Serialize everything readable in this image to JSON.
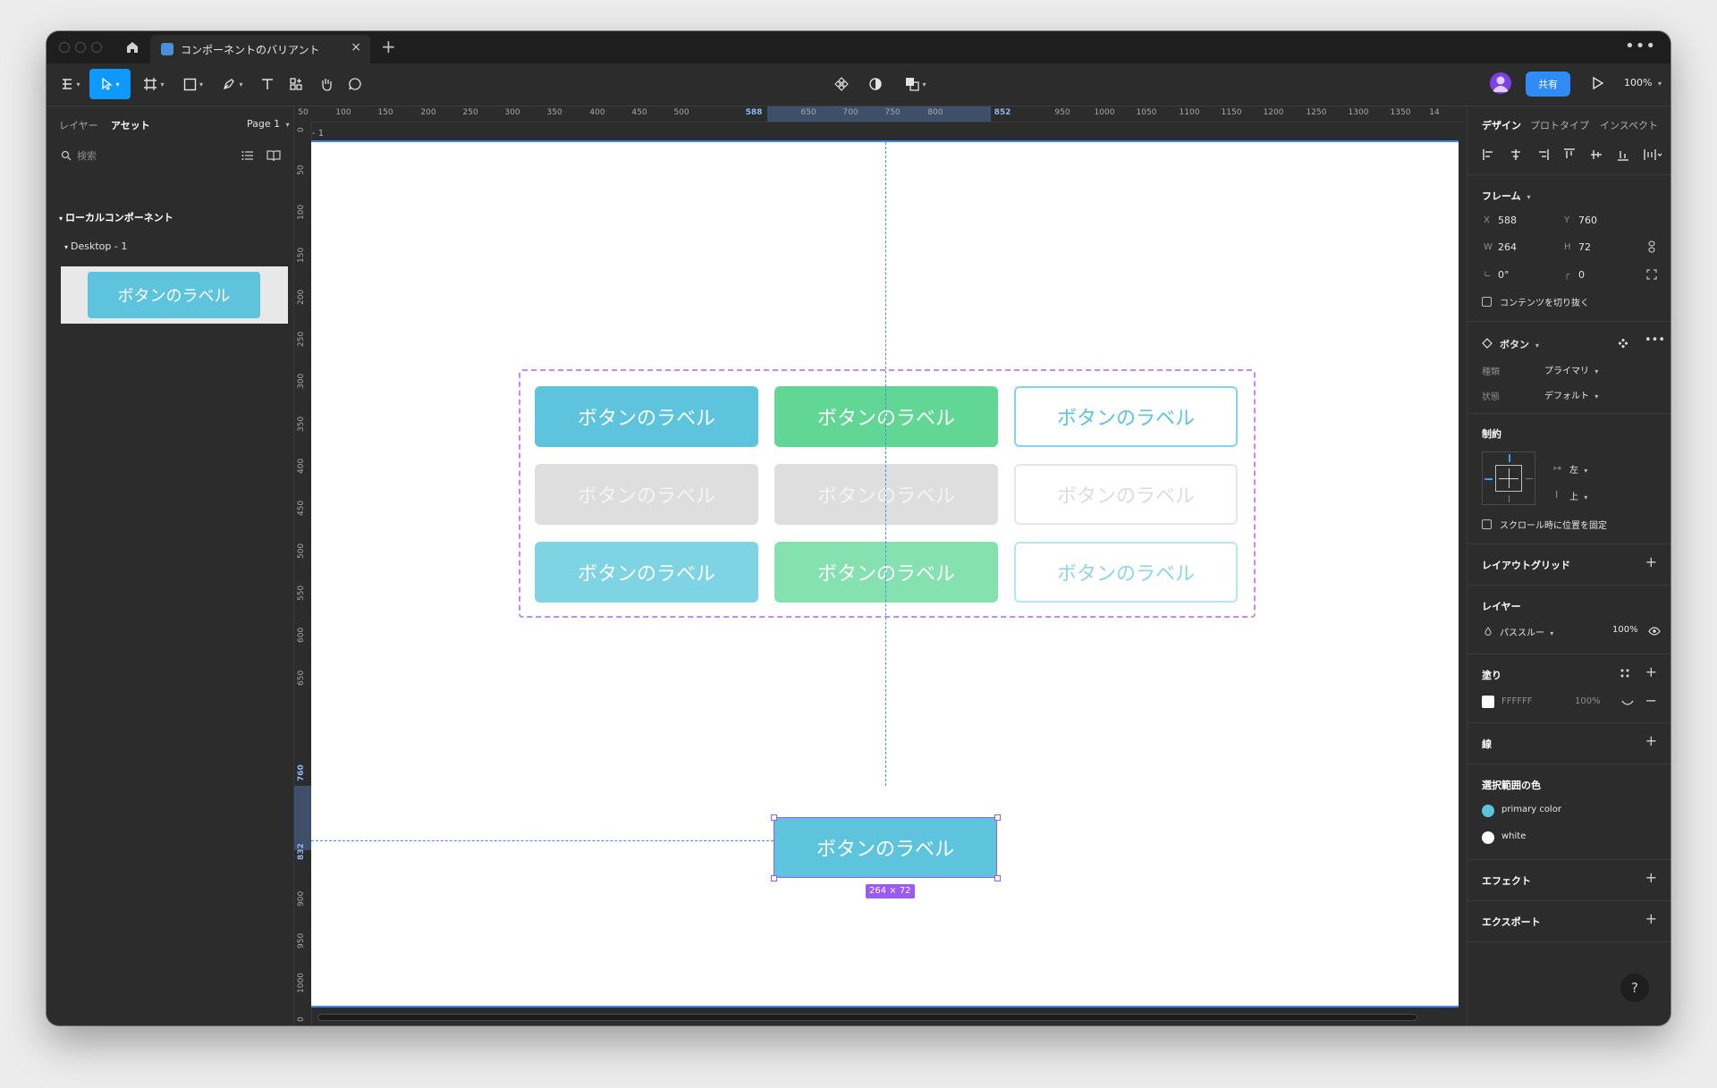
{
  "tab": {
    "title": "コンポーネントのバリアント"
  },
  "toolbar": {
    "share_label": "共有",
    "zoom": "100%"
  },
  "left_panel": {
    "tab_layers": "レイヤー",
    "tab_assets": "アセット",
    "page": "Page 1",
    "search_placeholder": "検索",
    "section_local": "ローカルコンポーネント",
    "frame_name": "Desktop - 1",
    "thumb_label": "ボタンのラベル"
  },
  "rulers": {
    "h_ticks": [
      "50",
      "100",
      "150",
      "200",
      "250",
      "300",
      "350",
      "400",
      "450",
      "500",
      "588",
      "650",
      "700",
      "750",
      "800",
      "852",
      "950",
      "1000",
      "1050",
      "1100",
      "1150",
      "1200",
      "1250",
      "1300",
      "1350",
      "14"
    ],
    "v_ticks": [
      "0",
      "50",
      "100",
      "150",
      "200",
      "250",
      "300",
      "350",
      "400",
      "450",
      "500",
      "550",
      "600",
      "650",
      "760",
      "832",
      "900",
      "950",
      "1000",
      "0"
    ]
  },
  "canvas": {
    "frame_label": "- 1",
    "variants": [
      [
        "ボタンのラベル",
        "ボタンのラベル",
        "ボタンのラベル"
      ],
      [
        "ボタンのラベル",
        "ボタンのラベル",
        "ボタンのラベル"
      ],
      [
        "ボタンのラベル",
        "ボタンのラベル",
        "ボタンのラベル"
      ]
    ],
    "selected_label": "ボタンのラベル",
    "size_badge": "264 × 72"
  },
  "right_panel": {
    "tabs": [
      "デザイン",
      "プロトタイプ",
      "インスペクト"
    ],
    "frame": {
      "title": "フレーム",
      "x_label": "X",
      "x": "588",
      "y_label": "Y",
      "y": "760",
      "w_label": "W",
      "w": "264",
      "h_label": "H",
      "h": "72",
      "rotation": "0°",
      "radius": "0",
      "clip_label": "コンテンツを切り抜く"
    },
    "component": {
      "title": "ボタン",
      "type_label": "種類",
      "type_value": "プライマリ",
      "state_label": "状態",
      "state_value": "デフォルト"
    },
    "constraints": {
      "title": "制約",
      "horizontal": "左",
      "vertical": "上",
      "fix_scroll_label": "スクロール時に位置を固定"
    },
    "layout_grid": "レイアウトグリッド",
    "layer": {
      "title": "レイヤー",
      "blend": "パススルー",
      "opacity": "100%"
    },
    "fill": {
      "title": "塗り",
      "hex": "FFFFFF",
      "opacity": "100%"
    },
    "stroke": "線",
    "selection_colors": {
      "title": "選択範囲の色",
      "items": [
        {
          "name": "primary color",
          "color": "#5ec3dc"
        },
        {
          "name": "white",
          "color": "#ffffff"
        }
      ]
    },
    "effects": "エフェクト",
    "export": "エクスポート"
  },
  "help": "?"
}
